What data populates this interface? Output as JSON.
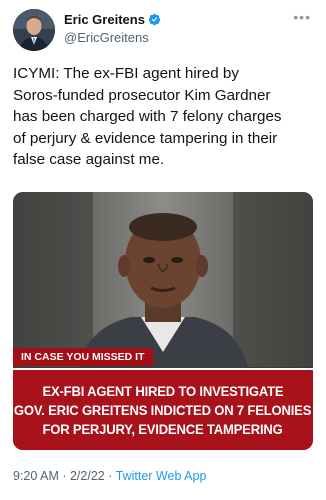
{
  "author": {
    "display_name": "Eric Greitens",
    "handle": "@EricGreitens",
    "verified_icon": "verified-badge-icon",
    "verified_color": "#1d9bf0"
  },
  "more_label": "•••",
  "tweet": {
    "text": "ICYMI: The ex-FBI agent hired by\nSoros-funded prosecutor Kim Gardner\nhas been charged with 7 felony charges\nof perjury & evidence tampering in their\nfalse case against me."
  },
  "media": {
    "tag": "IN CASE YOU MISSED IT",
    "headline": [
      "EX-FBI AGENT HIRED TO INVESTIGATE",
      "GOV. ERIC GREITENS INDICTED ON 7 FELONIES",
      "FOR PERJURY, EVIDENCE TAMPERING"
    ],
    "banner_color": "#a8121b"
  },
  "meta": {
    "time": "9:20 AM",
    "date": "2/2/22",
    "separator": " · ",
    "source": "Twitter Web App"
  }
}
